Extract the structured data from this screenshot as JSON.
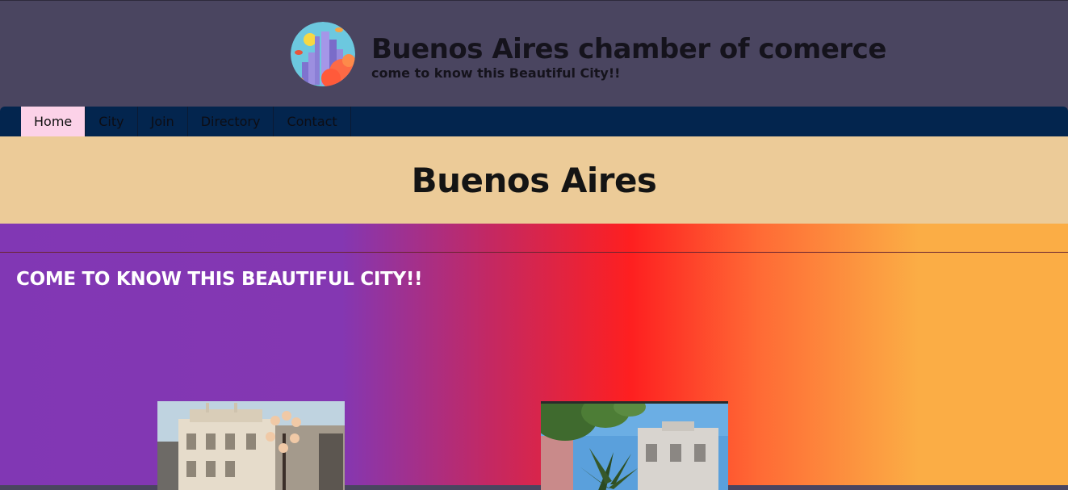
{
  "header": {
    "title": "Buenos Aires chamber of comerce",
    "tagline": "come to know this Beautiful City!!",
    "logo_icon": "city-skyline-logo"
  },
  "nav": {
    "items": [
      {
        "label": "Home",
        "active": true
      },
      {
        "label": "City",
        "active": false
      },
      {
        "label": "Join",
        "active": false
      },
      {
        "label": "Directory",
        "active": false
      },
      {
        "label": "Contact",
        "active": false
      }
    ]
  },
  "hero": {
    "title": "Buenos Aires"
  },
  "main": {
    "heading": "COME TO KNOW THIS BEAUTIFUL CITY!!",
    "photos": [
      {
        "icon": "building-streetlamp-photo"
      },
      {
        "icon": "building-tree-photo"
      }
    ]
  },
  "colors": {
    "header_bg": "#4a4560",
    "nav_bg": "#03254e",
    "nav_active_bg": "#fcd2e8",
    "hero_bg": "#eccb98",
    "gradient_start": "#8137b4",
    "gradient_mid": "#fe1f20",
    "gradient_end": "#fbad45"
  }
}
